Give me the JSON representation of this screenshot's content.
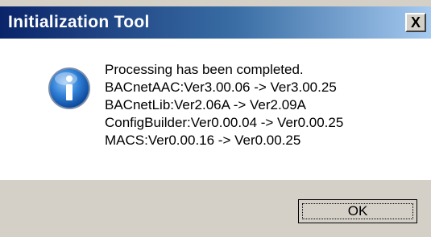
{
  "window": {
    "title": "Initialization Tool",
    "close_label": "X"
  },
  "dialog": {
    "icon": "info-icon",
    "message_lines": [
      "Processing has been completed.",
      "BACnetAAC:Ver3.00.06 -> Ver3.00.25",
      "BACnetLib:Ver2.06A -> Ver2.09A",
      "ConfigBuilder:Ver0.00.04 -> Ver0.00.25",
      "MACS:Ver0.00.16 -> Ver0.00.25"
    ]
  },
  "buttons": {
    "ok_label": "OK"
  },
  "colors": {
    "titlebar_start": "#0a246a",
    "titlebar_end": "#a6caf0",
    "face": "#d4d0c8",
    "content_bg": "#ffffff",
    "icon_blue": "#1f6fc7"
  }
}
